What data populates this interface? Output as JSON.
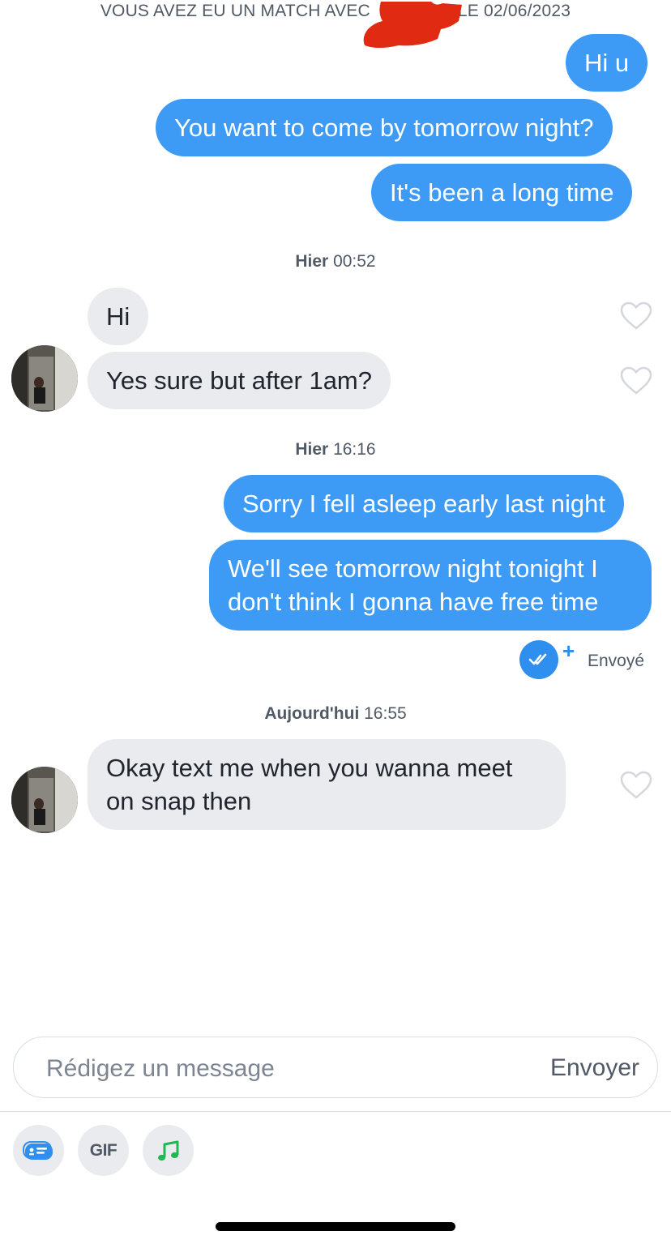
{
  "header": {
    "match_prefix": "VOUS AVEZ EU UN MATCH AVEC",
    "match_suffix": "LE 02/06/2023"
  },
  "messages_group1": [
    {
      "text": "Hi u",
      "from": "me"
    },
    {
      "text": "You want to come by tomorrow night?",
      "from": "me"
    },
    {
      "text": "It's been a long time",
      "from": "me"
    }
  ],
  "timestamps": [
    {
      "day": "Hier",
      "time": "00:52"
    },
    {
      "day": "Hier",
      "time": "16:16"
    },
    {
      "day": "Aujourd'hui",
      "time": "16:55"
    }
  ],
  "messages_group2": [
    {
      "text": "Hi",
      "from": "match"
    },
    {
      "text": "Yes sure but after 1am?",
      "from": "match"
    }
  ],
  "messages_group3": [
    {
      "text": "Sorry I fell asleep early last night",
      "from": "me"
    },
    {
      "text": "We'll see tomorrow night tonight I don't think I gonna have free time",
      "from": "me"
    }
  ],
  "status": {
    "sent_label": "Envoyé",
    "plus": "+"
  },
  "messages_group4": [
    {
      "text": "Okay text me when you wanna meet on snap then",
      "from": "match"
    }
  ],
  "composer": {
    "placeholder": "Rédigez un message",
    "send_label": "Envoyer"
  },
  "toolbar": {
    "gif_label": "GIF",
    "items": [
      "sticker-icon",
      "gif-icon",
      "music-icon"
    ]
  },
  "colors": {
    "sent_bubble": "#3d9bf5",
    "received_bubble": "#e9ebef",
    "redaction": "#e02a12",
    "music_icon": "#1db954"
  }
}
